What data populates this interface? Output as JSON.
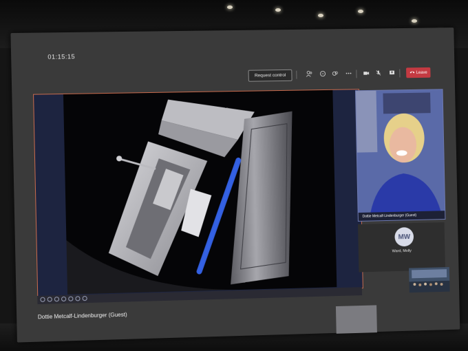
{
  "meeting": {
    "timer": "01:15:15",
    "request_control_label": "Request control",
    "leave_label": "Leave",
    "presenter_name": "Dottie Metcalf-Lindenburger (Guest)"
  },
  "video_tile": {
    "caption": "Dottie Metcalf-Lindenburger (Guest)"
  },
  "participant": {
    "initials": "MW",
    "name": "Ward, Molly"
  },
  "colors": {
    "leave": "#c43a42",
    "accent_frame": "#c86a4c",
    "tile_blue": "#3b4a80"
  },
  "icons": [
    "people-icon",
    "chat-icon",
    "reactions-icon",
    "more-icon",
    "camera-icon",
    "mic-off-icon",
    "share-icon",
    "phone-icon"
  ]
}
